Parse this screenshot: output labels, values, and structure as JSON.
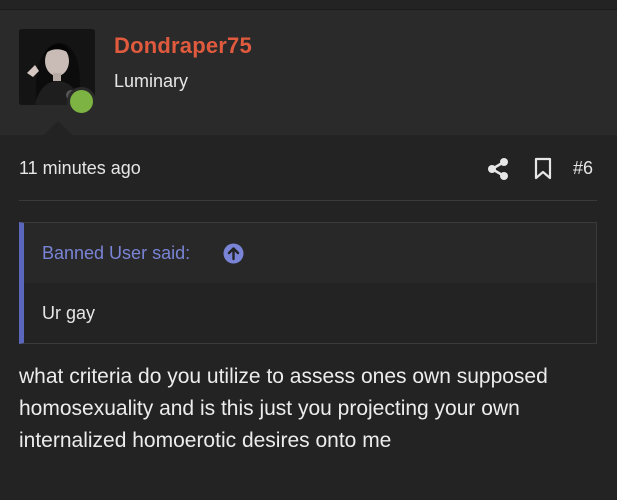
{
  "post": {
    "username": "Dondraper75",
    "user_title": "Luminary",
    "timestamp": "11 minutes ago",
    "post_number": "#6",
    "quote": {
      "author_label": "Banned User said:",
      "text": "Ur gay"
    },
    "message": "what criteria do you utilize to assess ones own supposed homosexuality and is this just you projecting your own internalized homoerotic desires onto me"
  },
  "icons": {
    "share": "share-icon",
    "bookmark": "bookmark-icon",
    "goto_quote": "arrow-up-circle-icon",
    "online": "online-status-icon"
  },
  "colors": {
    "background": "#232323",
    "username": "#e05a3e",
    "quote_accent": "#5b66bd",
    "quote_author": "#7a84d6",
    "online": "#7cb342",
    "text": "#e6e6e6"
  }
}
